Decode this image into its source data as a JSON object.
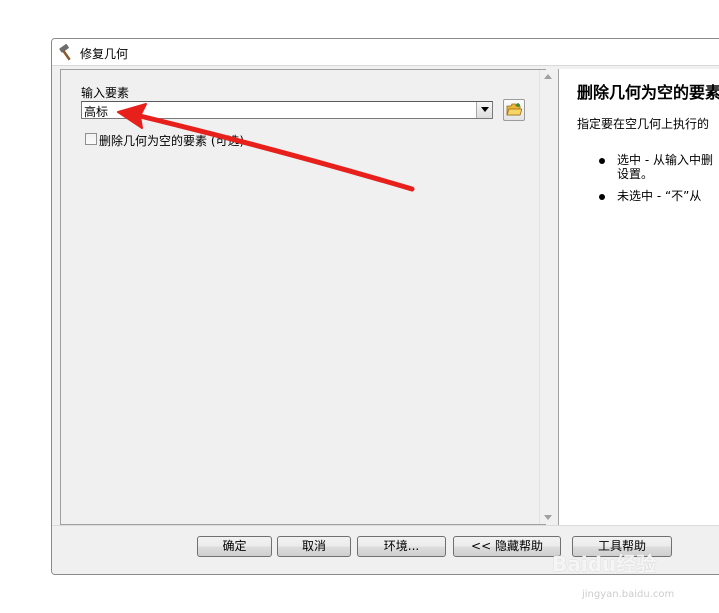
{
  "window": {
    "title": "修复几何",
    "icon": "hammer-icon"
  },
  "params": {
    "input_label": "输入要素",
    "input_value": "高标",
    "delete_null_label": "删除几何为空的要素 (可选)",
    "delete_null_checked": false
  },
  "help": {
    "title": "删除几何为空的要素",
    "desc": "指定要在空几何上执行的",
    "bullets": [
      {
        "line1": "选中 - 从输入中删",
        "line2": "设置。"
      },
      {
        "line1": "未选中 - “不”从",
        "line2": ""
      }
    ]
  },
  "footer": {
    "ok": "确定",
    "cancel": "取消",
    "env": "环境...",
    "hide_help": "<< 隐藏帮助",
    "tool_help": "工具帮助"
  },
  "watermark": {
    "brand": "Baidu经验",
    "url": "jingyan.baidu.com"
  },
  "colors": {
    "annotation_arrow": "#e8201c"
  }
}
